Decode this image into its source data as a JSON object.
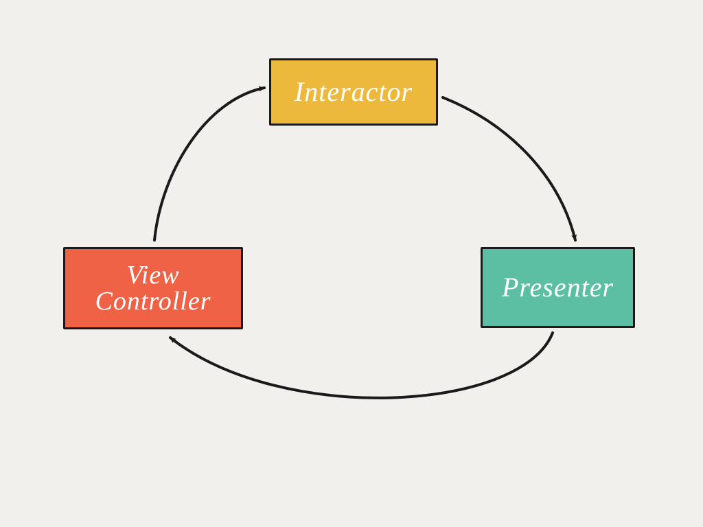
{
  "diagram": {
    "nodes": {
      "interactor": {
        "label": "Interactor",
        "fill": "#edb93d"
      },
      "view_controller": {
        "label": "View Controller",
        "fill": "#f06246"
      },
      "presenter": {
        "label": "Presenter",
        "fill": "#5cbfa3"
      }
    },
    "arrows": [
      {
        "from": "view_controller",
        "to": "interactor"
      },
      {
        "from": "interactor",
        "to": "presenter"
      },
      {
        "from": "presenter",
        "to": "view_controller"
      }
    ],
    "colors": {
      "stroke": "#1a1a1a",
      "background": "#f2f0ed",
      "text": "#ffffff"
    }
  }
}
